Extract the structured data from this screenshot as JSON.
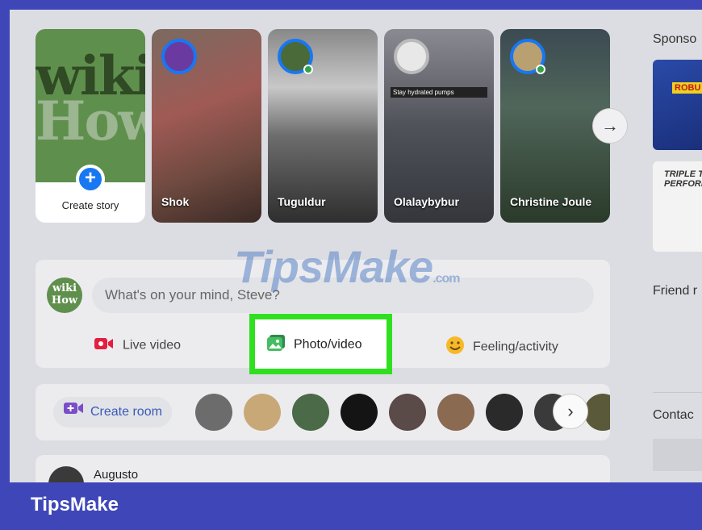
{
  "stories": {
    "create_label": "Create story",
    "logo_text": [
      "wiki",
      "How"
    ],
    "items": [
      {
        "name": "Shok"
      },
      {
        "name": "Tuguldur"
      },
      {
        "name": "Olalaybybur",
        "caption": "Stay hydrated pumps"
      },
      {
        "name": "Christine Joule"
      }
    ]
  },
  "sidebar": {
    "sponsored_title": "Sponso",
    "ad_text": "TRIPLE T PERFORM",
    "ad_badge": "ROBU",
    "friend_title": "Friend r",
    "contacts_title": "Contac"
  },
  "composer": {
    "avatar_text": [
      "wiki",
      "How"
    ],
    "placeholder": "What's on your mind, Steve?",
    "actions": {
      "live": "Live video",
      "photo": "Photo/video",
      "feeling": "Feeling/activity"
    }
  },
  "rooms": {
    "create_label": "Create room"
  },
  "post": {
    "author": "Augusto",
    "more": "..."
  },
  "watermark": {
    "text": "TipsMake",
    "suffix": ".com"
  },
  "banner": "TipsMake",
  "colors": {
    "accent_blue": "#1877f2",
    "highlight_green": "#30e020",
    "banner_bg": "#3f47b8",
    "online_green": "#31a24c"
  }
}
